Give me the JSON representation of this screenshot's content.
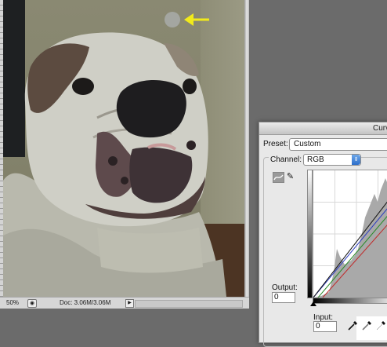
{
  "document": {
    "zoom": "50%",
    "doc_size": "Doc: 3.06M/3.06M",
    "annotation_arrow_color": "#f2ea1a"
  },
  "curves_dialog": {
    "title": "Curv",
    "preset_label": "Preset:",
    "preset_value": "Custom",
    "channel_label": "Channel:",
    "channel_value": "RGB",
    "output_label": "Output:",
    "output_value": "0",
    "input_label": "Input:",
    "input_value": "0",
    "icons": {
      "curve_tool": "curve-edit-icon",
      "pencil_tool": "pencil-icon",
      "black_point": "black-eyedropper-icon",
      "gray_point": "gray-eyedropper-icon",
      "white_point": "white-eyedropper-icon"
    }
  }
}
